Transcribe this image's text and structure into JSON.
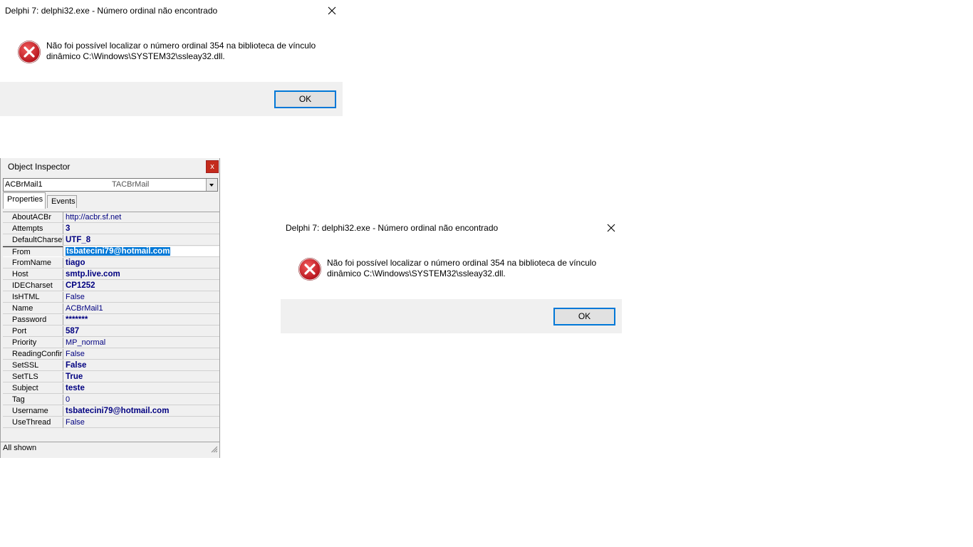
{
  "dialog1": {
    "title": "Delphi 7: delphi32.exe - Número ordinal não encontrado",
    "message": "Não foi possível localizar o número ordinal 354 na biblioteca de vínculo dinâmico C:\\Windows\\SYSTEM32\\ssleay32.dll.",
    "ok_label": "OK"
  },
  "dialog2": {
    "title": "Delphi 7: delphi32.exe - Número ordinal não encontrado",
    "message": "Não foi possível localizar o número ordinal 354 na biblioteca de vínculo dinâmico C:\\Windows\\SYSTEM32\\ssleay32.dll.",
    "ok_label": "OK"
  },
  "object_inspector": {
    "title": "Object Inspector",
    "close_glyph": "x",
    "object_name": "ACBrMail1",
    "object_type": "TACBrMail",
    "tabs": [
      "Properties",
      "Events"
    ],
    "status": "All shown",
    "properties": [
      {
        "name": "AboutACBr",
        "value": "http://acbr.sf.net"
      },
      {
        "name": "Attempts",
        "value": "3"
      },
      {
        "name": "DefaultCharset",
        "value": "UTF_8"
      },
      {
        "name": "From",
        "value": "tsbatecini79@hotmail.com"
      },
      {
        "name": "FromName",
        "value": "tiago"
      },
      {
        "name": "Host",
        "value": "smtp.live.com"
      },
      {
        "name": "IDECharset",
        "value": "CP1252"
      },
      {
        "name": "IsHTML",
        "value": "False"
      },
      {
        "name": "Name",
        "value": "ACBrMail1"
      },
      {
        "name": "Password",
        "value": "*******"
      },
      {
        "name": "Port",
        "value": "587"
      },
      {
        "name": "Priority",
        "value": "MP_normal"
      },
      {
        "name": "ReadingConfirm",
        "value": "False"
      },
      {
        "name": "SetSSL",
        "value": "False"
      },
      {
        "name": "SetTLS",
        "value": "True"
      },
      {
        "name": "Subject",
        "value": "teste"
      },
      {
        "name": "Tag",
        "value": "0"
      },
      {
        "name": "Username",
        "value": "tsbatecini79@hotmail.com"
      },
      {
        "name": "UseThread",
        "value": "False"
      }
    ]
  }
}
